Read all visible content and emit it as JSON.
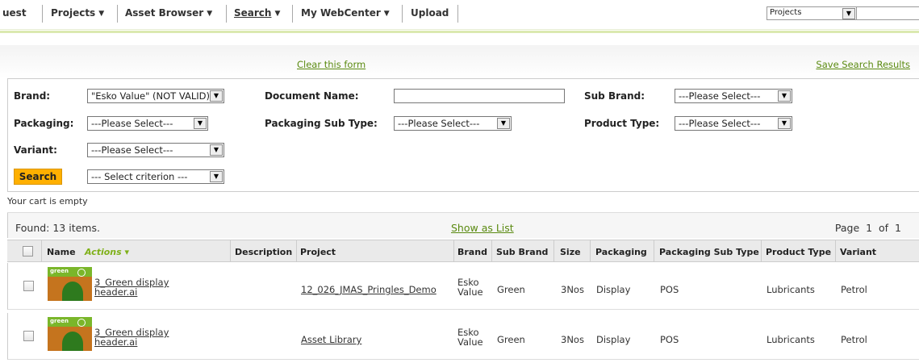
{
  "nav": {
    "items": [
      {
        "label": "uest",
        "arrow": false
      },
      {
        "label": "Projects",
        "arrow": true
      },
      {
        "label": "Asset Browser",
        "arrow": true
      },
      {
        "label": "Search",
        "arrow": true
      },
      {
        "label": "My WebCenter",
        "arrow": true
      },
      {
        "label": "Upload",
        "arrow": false
      }
    ],
    "search_scope": "Projects",
    "search_value": ""
  },
  "toolbar": {
    "clear_label": "Clear this form",
    "save_label": "Save Search Results"
  },
  "form": {
    "brand_label": "Brand:",
    "brand_value": "\"Esko Value\" (NOT VALID)",
    "docname_label": "Document Name:",
    "docname_value": "",
    "subbrand_label": "Sub Brand:",
    "subbrand_value": "---Please Select---",
    "packaging_label": "Packaging:",
    "packaging_value": "---Please Select---",
    "pkgsub_label": "Packaging Sub Type:",
    "pkgsub_value": "---Please Select---",
    "producttype_label": "Product Type:",
    "producttype_value": "---Please Select---",
    "variant_label": "Variant:",
    "variant_value": "---Please Select---",
    "search_button": "Search",
    "criterion_value": "--- Select criterion ---"
  },
  "cart": {
    "status": "Your cart is empty"
  },
  "results": {
    "found": "Found: 13 items.",
    "show_as_list": "Show as List",
    "page_label": "Page",
    "page_current": "1",
    "page_of": "of",
    "page_total": "1"
  },
  "table": {
    "headers": {
      "name": "Name",
      "actions": "Actions ▾",
      "description": "Description",
      "project": "Project",
      "brand": "Brand",
      "sub_brand": "Sub Brand",
      "size": "Size",
      "packaging": "Packaging",
      "packaging_sub_type": "Packaging Sub Type",
      "product_type": "Product Type",
      "variant": "Variant"
    },
    "rows": [
      {
        "thumb_text": "green",
        "name_line1": "3_Green display",
        "name_line2": "header.ai",
        "description": "",
        "project": "12_026_JMAS_Pringles_Demo",
        "brand_line1": "Esko",
        "brand_line2": "Value",
        "sub_brand": "Green",
        "size": "3Nos",
        "packaging": "Display",
        "packaging_sub_type": "POS",
        "product_type": "Lubricants",
        "variant": "Petrol"
      },
      {
        "thumb_text": "green",
        "name_line1": "3_Green display",
        "name_line2": "header.ai",
        "description": "",
        "project": "Asset Library",
        "brand_line1": "Esko",
        "brand_line2": "Value",
        "sub_brand": "Green",
        "size": "3Nos",
        "packaging": "Display",
        "packaging_sub_type": "POS",
        "product_type": "Lubricants",
        "variant": "Petrol"
      }
    ]
  }
}
